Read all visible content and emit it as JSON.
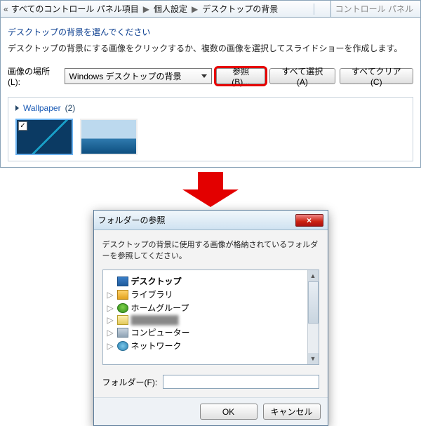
{
  "breadcrumb": {
    "chev": "«",
    "items": [
      "すべてのコントロール パネル項目",
      "個人設定",
      "デスクトップの背景"
    ],
    "sep": "▶",
    "search": "コントロール パネル"
  },
  "main": {
    "title": "デスクトップの背景を選んでください",
    "desc": "デスクトップの背景にする画像をクリックするか、複数の画像を選択してスライドショーを作成します。",
    "locationLabel": "画像の場所(L):",
    "selectValue": "Windows デスクトップの背景",
    "browseBtn": "参照(B)...",
    "selectAllBtn": "すべて選択(A)",
    "clearAllBtn": "すべてクリア(C)",
    "group": {
      "name": "Wallpaper",
      "count": "(2)"
    },
    "check": "✓"
  },
  "dialog": {
    "title": "フォルダーの参照",
    "msg": "デスクトップの背景に使用する画像が格納されているフォルダーを参照してください。",
    "items": [
      "デスクトップ",
      "ライブラリ",
      "ホームグループ",
      "",
      "コンピューター",
      "ネットワーク"
    ],
    "folderLabel": "フォルダー(F):",
    "ok": "OK",
    "cancel": "キャンセル",
    "arrowUp": "▲",
    "arrowDn": "▼",
    "arrowR": "▷"
  }
}
